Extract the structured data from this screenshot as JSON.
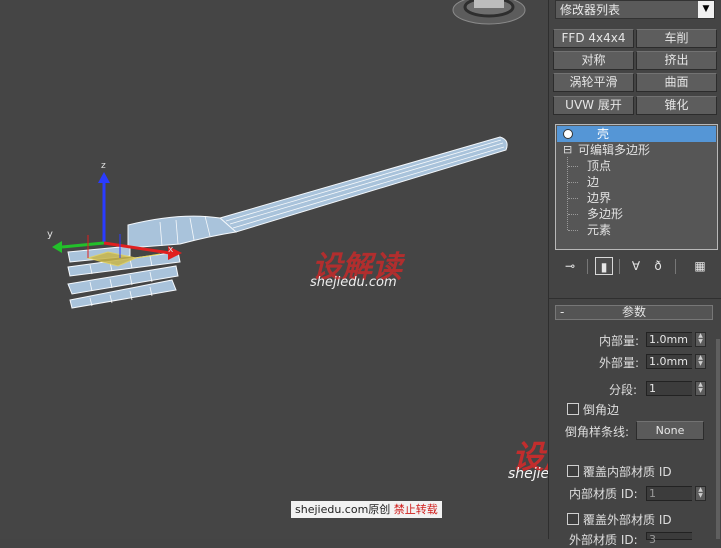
{
  "panel": {
    "modifier_list": "修改器列表",
    "dropdown_arrow": "▼",
    "buttons": [
      "FFD 4x4x4",
      "车削",
      "对称",
      "挤出",
      "涡轮平滑",
      "曲面",
      "UVW 展开",
      "锥化"
    ],
    "stack": {
      "shell": "壳",
      "edit_poly": "可编辑多边形",
      "expand_symbol": "⊟",
      "sub": [
        "顶点",
        "边",
        "边界",
        "多边形",
        "元素"
      ]
    },
    "stack_tools": [
      "pin-stack-icon",
      "show-end-result-icon",
      "make-unique-icon",
      "remove-modifier-icon",
      "configure-modifier-sets-icon"
    ],
    "rollout": {
      "collapse": "-",
      "title": "参数",
      "inner_amount_label": "内部量:",
      "inner_amount_value": "1.0mm",
      "outer_amount_label": "外部量:",
      "outer_amount_value": "1.0mm",
      "segments_label": "分段:",
      "segments_value": "1",
      "bevel_edges_label": "倒角边",
      "bevel_spline_label": "倒角样条线:",
      "bevel_spline_value": "None",
      "override_inner_label": "覆盖内部材质 ID",
      "inner_mat_label": "内部材质 ID:",
      "inner_mat_value": "1",
      "override_outer_label": "覆盖外部材质 ID",
      "outer_mat_label": "外部材质 ID:",
      "outer_mat_value": "3"
    }
  },
  "viewport": {
    "gizmo_axes": {
      "x": "x",
      "y": "y",
      "z": "z"
    },
    "watermark_logo": "设解读",
    "watermark_url": "shejiedu.com",
    "copyright_site": "shejiedu.com原创",
    "copyright_notice": "禁止转载"
  },
  "colors": {
    "viewport_bg": "#454545",
    "panel_bg": "#444444",
    "selection": "#5596d6",
    "mesh": "#aac4dc",
    "watermark_red": "#d42a2a"
  }
}
